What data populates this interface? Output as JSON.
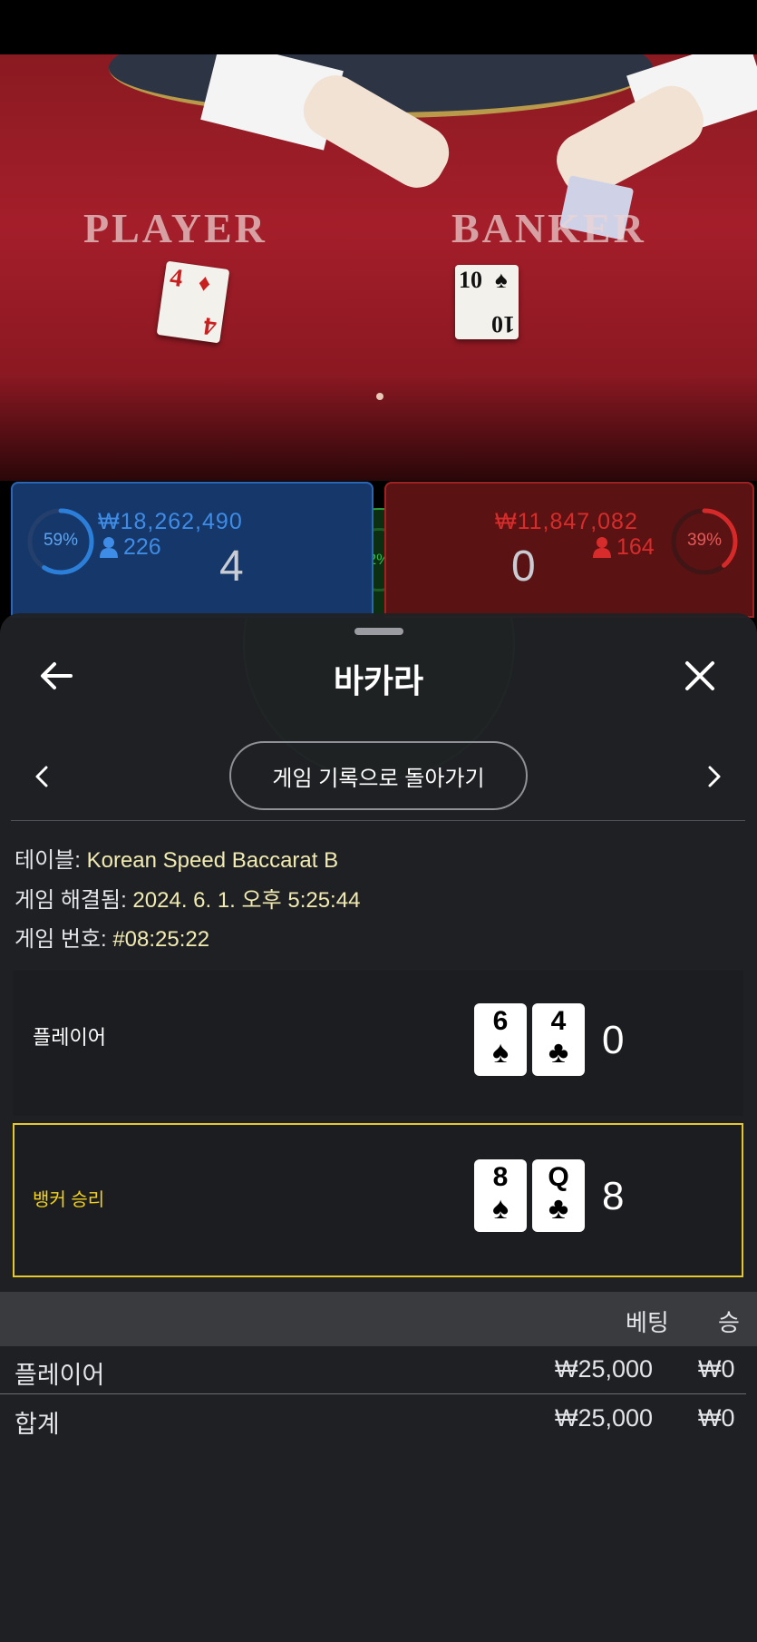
{
  "video": {
    "player_label": "PLAYER",
    "banker_label": "BANKER",
    "player_card": {
      "rank": "4",
      "suit": "♦"
    },
    "banker_card": {
      "rank": "10",
      "suit": "♠"
    }
  },
  "betting": {
    "player": {
      "percent": "59%",
      "percent_value": 0.59,
      "amount": "₩18,262,490",
      "count": "226",
      "score": "4",
      "color": "#2b7fd9"
    },
    "banker": {
      "percent": "39%",
      "percent_value": 0.39,
      "amount": "₩11,847,082",
      "count": "164",
      "score": "0",
      "color": "#d62a2a"
    },
    "tie": {
      "percent": "2%",
      "percent_value": 0.02,
      "color": "#2fc04a"
    }
  },
  "modal": {
    "title": "바카라",
    "history_button": "게임 기록으로 돌아가기",
    "info": {
      "table_label": "테이블:",
      "table_value": "Korean Speed Baccarat B",
      "resolved_label": "게임 해결됨:",
      "resolved_value": "2024. 6. 1. 오후 5:25:44",
      "game_no_label": "게임 번호:",
      "game_no_value": "#08:25:22"
    },
    "hands": {
      "player": {
        "label": "플레이어",
        "cards": [
          {
            "rank": "6",
            "suit": "♠"
          },
          {
            "rank": "4",
            "suit": "♣"
          }
        ],
        "score": "0"
      },
      "banker": {
        "label": "뱅커 승리",
        "label_color": "#f2d21e",
        "cards": [
          {
            "rank": "8",
            "suit": "♠"
          },
          {
            "rank": "Q",
            "suit": "♣"
          }
        ],
        "score": "8"
      }
    },
    "bets_table": {
      "headers": [
        "베팅",
        "승"
      ],
      "rows": [
        {
          "name": "플레이어",
          "bet": "₩25,000",
          "win": "₩0"
        }
      ],
      "total": {
        "name": "합계",
        "bet": "₩25,000",
        "win": "₩0"
      }
    }
  }
}
